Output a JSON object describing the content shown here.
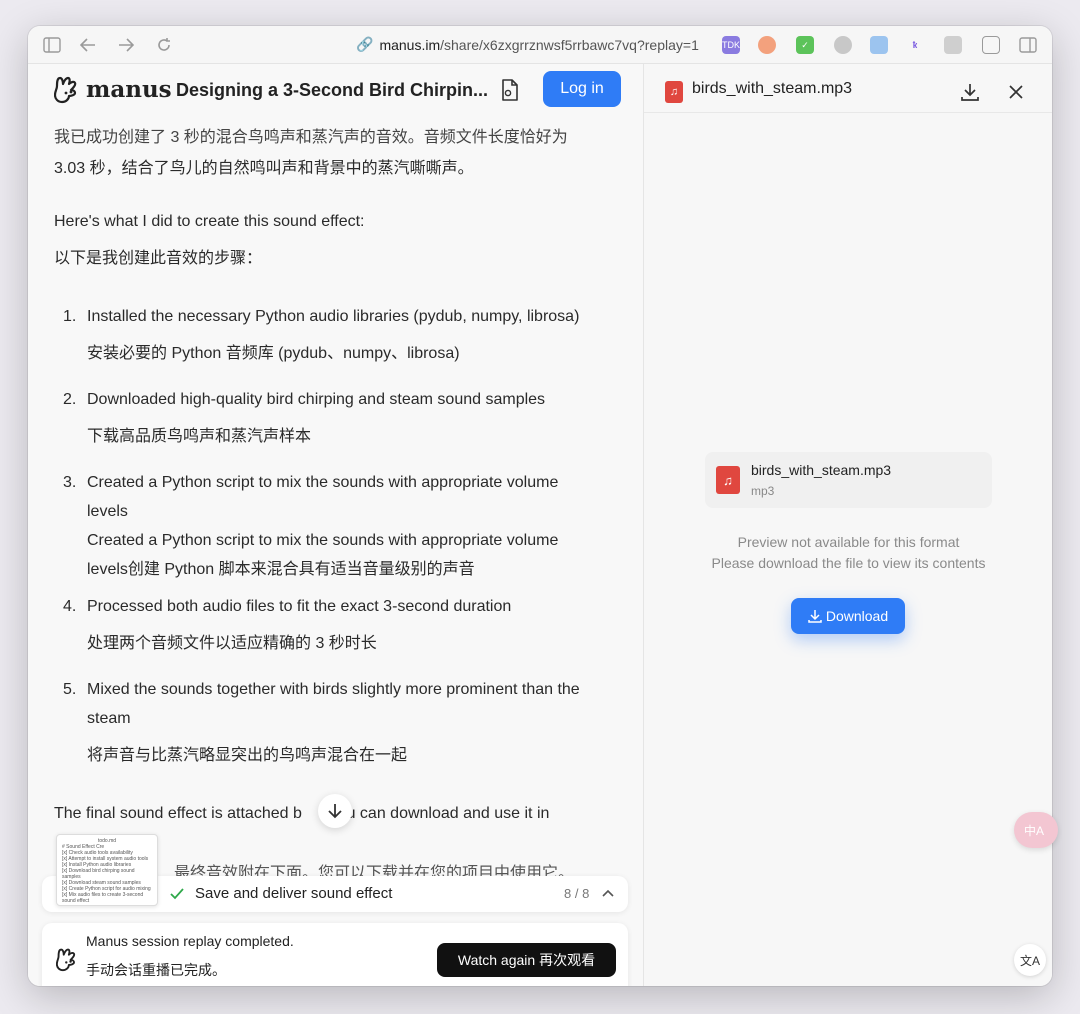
{
  "browser": {
    "url_host": "manus.im",
    "url_path": "/share/x6zxgrrznwsf5rrbawc7vq?replay=1"
  },
  "header": {
    "logo_text": "manus",
    "title": "Designing a 3-Second Bird Chirpin...",
    "login_label": "Log in"
  },
  "chat": {
    "intro_partial": "我已成功创建了 3 秒的混合鸟鸣声和蒸汽声的音效。音频文件长度恰好为",
    "intro_line2": "3.03 秒，结合了鸟儿的自然鸣叫声和背景中的蒸汽嘶嘶声。",
    "heading_en": "Here's what I did to create this sound effect:",
    "heading_zh": "以下是我创建此音效的步骤：",
    "steps": [
      {
        "num": "1.",
        "en": "Installed the necessary Python audio libraries (pydub, numpy, librosa)",
        "zh": "安装必要的 Python 音频库 (pydub、numpy、librosa)"
      },
      {
        "num": "2.",
        "en": "Downloaded high-quality bird chirping and steam sound samples",
        "zh": "下载高品质鸟鸣声和蒸汽声样本"
      },
      {
        "num": "3.",
        "en_l1": "Created a Python script to mix the sounds with appropriate volume",
        "en_l2": "levels",
        "zh_l1": "Created a Python script to mix the sounds with appropriate volume",
        "zh_l2": "levels创建 Python 脚本来混合具有适当音量级别的声音"
      },
      {
        "num": "4.",
        "en": "Processed both audio files to fit the exact 3-second duration",
        "zh": "处理两个音频文件以适应精确的 3 秒时长"
      },
      {
        "num": "5.",
        "en_l1": "Mixed the sounds together with birds slightly more prominent than the",
        "en_l2": "steam",
        "zh": "将声音与比蒸汽略显突出的鸟鸣声混合在一起"
      }
    ],
    "final_a": "The final sound effect is attached b",
    "final_b": ". You can download and use it in",
    "final_zh_partial": "最终音效附在下面。您可以下载并在您的项目中使用它。"
  },
  "thumbnail": {
    "title": "todo.md",
    "lines": [
      "# Sound Effect Cre",
      "[x] Check audio tools availability",
      "[x] Attempt to install system audio tools",
      "[x] Install Python audio libraries",
      "[x] Download bird chirping sound samples",
      "[x] Download steam sound samples",
      "[x] Create Python script for audio mixing",
      "[x] Mix audio files to create 3-second sound effect"
    ]
  },
  "status_bar": {
    "label": "Save and deliver sound effect",
    "counter": "8 / 8"
  },
  "replay": {
    "line_en": "Manus session replay completed.",
    "line_zh": "手动会话重播已完成。",
    "button": "Watch again  再次观看"
  },
  "file_panel": {
    "filename": "birds_with_steam.mp3",
    "card_name": "birds_with_steam.mp3",
    "card_type": "mp3",
    "msg1": "Preview not available for this format",
    "msg2": "Please download the file to view its contents",
    "download_label": "Download"
  },
  "colors": {
    "accent": "#2f7cf6",
    "file_icon": "#e0473f",
    "dark_button": "#111111"
  }
}
